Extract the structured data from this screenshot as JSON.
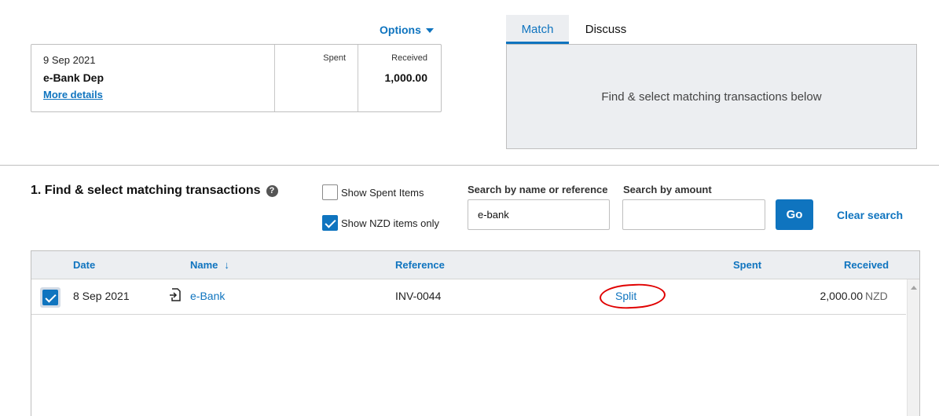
{
  "options": {
    "label": "Options"
  },
  "statement": {
    "date": "9 Sep 2021",
    "name": "e-Bank Dep",
    "more_details": "More details",
    "spent_header": "Spent",
    "received_header": "Received",
    "received_value": "1,000.00"
  },
  "tabs": [
    {
      "label": "Match",
      "active": true
    },
    {
      "label": "Discuss",
      "active": false
    }
  ],
  "match_panel": {
    "text": "Find & select matching transactions below"
  },
  "section": {
    "title": "1. Find & select matching transactions",
    "help_icon": "?"
  },
  "filters": {
    "show_spent": {
      "label": "Show Spent Items",
      "checked": false
    },
    "show_nzd": {
      "label": "Show NZD items only",
      "checked": true
    }
  },
  "search": {
    "name_label": "Search by name or reference",
    "name_value": "e-bank",
    "amount_label": "Search by amount",
    "amount_value": "",
    "go_label": "Go",
    "clear_label": "Clear search"
  },
  "table": {
    "headers": {
      "date": "Date",
      "name": "Name",
      "sort_arrow": "↓",
      "reference": "Reference",
      "spent": "Spent",
      "received": "Received"
    },
    "rows": [
      {
        "checked": true,
        "date": "8 Sep 2021",
        "icon": "document-arrow-icon",
        "name": "e-Bank",
        "reference": "INV-0044",
        "split": "Split",
        "spent": "",
        "received": "2,000.00",
        "currency": "NZD"
      }
    ]
  },
  "colors": {
    "accent": "#0f74bf",
    "panel_bg": "#eceef1",
    "annotation": "#e00000"
  }
}
